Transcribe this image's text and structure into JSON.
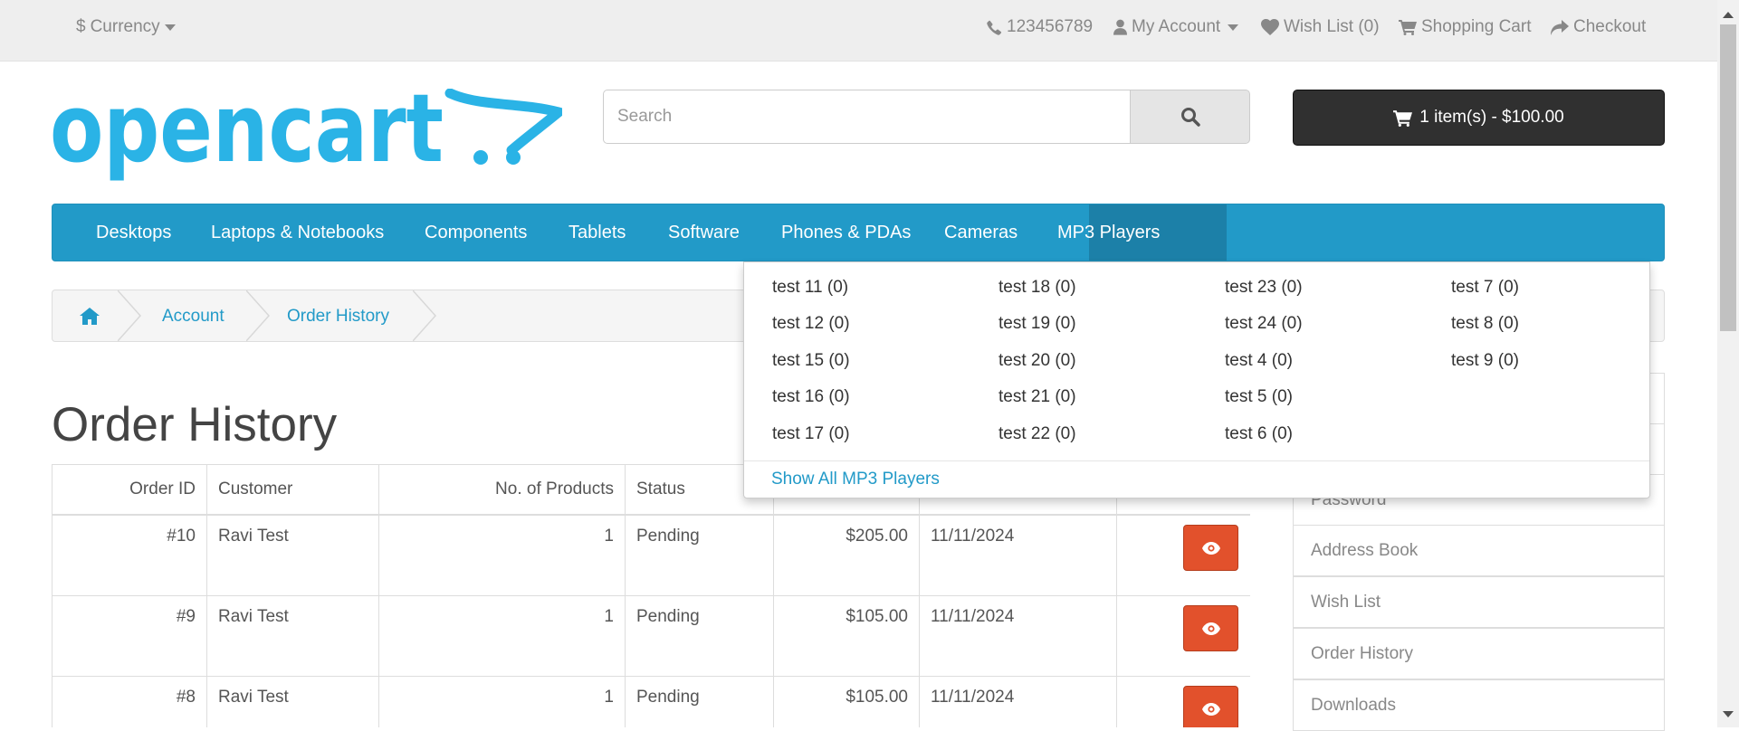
{
  "topbar": {
    "currency": "Currency",
    "phone": "123456789",
    "my_account": "My Account",
    "wish_list": "Wish List (0)",
    "shopping_cart": "Shopping Cart",
    "checkout": "Checkout"
  },
  "header": {
    "logo_text": "opencart",
    "search_placeholder": "Search",
    "cart_label": "1 item(s) - $100.00"
  },
  "menu": {
    "items": [
      "Desktops",
      "Laptops & Notebooks",
      "Components",
      "Tablets",
      "Software",
      "Phones & PDAs",
      "Cameras",
      "MP3 Players"
    ],
    "active": "MP3 Players"
  },
  "dropdown": {
    "columns": [
      [
        "test 11 (0)",
        "test 12 (0)",
        "test 15 (0)",
        "test 16 (0)",
        "test 17 (0)"
      ],
      [
        "test 18 (0)",
        "test 19 (0)",
        "test 20 (0)",
        "test 21 (0)",
        "test 22 (0)"
      ],
      [
        "test 23 (0)",
        "test 24 (0)",
        "test 4 (0)",
        "test 5 (0)",
        "test 6 (0)"
      ],
      [
        "test 7 (0)",
        "test 8 (0)",
        "test 9 (0)"
      ]
    ],
    "show_all": "Show All MP3 Players"
  },
  "breadcrumb": [
    "Account",
    "Order History"
  ],
  "page_title": "Order History",
  "table": {
    "headers": [
      "Order ID",
      "Customer",
      "No. of Products",
      "Status",
      "",
      "",
      ""
    ],
    "rows": [
      [
        "#10",
        "Ravi Test",
        "1",
        "Pending",
        "$205.00",
        "11/11/2024"
      ],
      [
        "#9",
        "Ravi Test",
        "1",
        "Pending",
        "$105.00",
        "11/11/2024"
      ],
      [
        "#8",
        "Ravi Test",
        "1",
        "Pending",
        "$105.00",
        "11/11/2024"
      ]
    ]
  },
  "sidebar": [
    "Password",
    "Address Book",
    "Wish List",
    "Order History",
    "Downloads"
  ],
  "colors": {
    "accent": "#229ac8",
    "menu_active": "#1c80a8",
    "view_button": "#e2512c",
    "cart_button": "#303030",
    "topbar_bg": "#eeeeee"
  }
}
